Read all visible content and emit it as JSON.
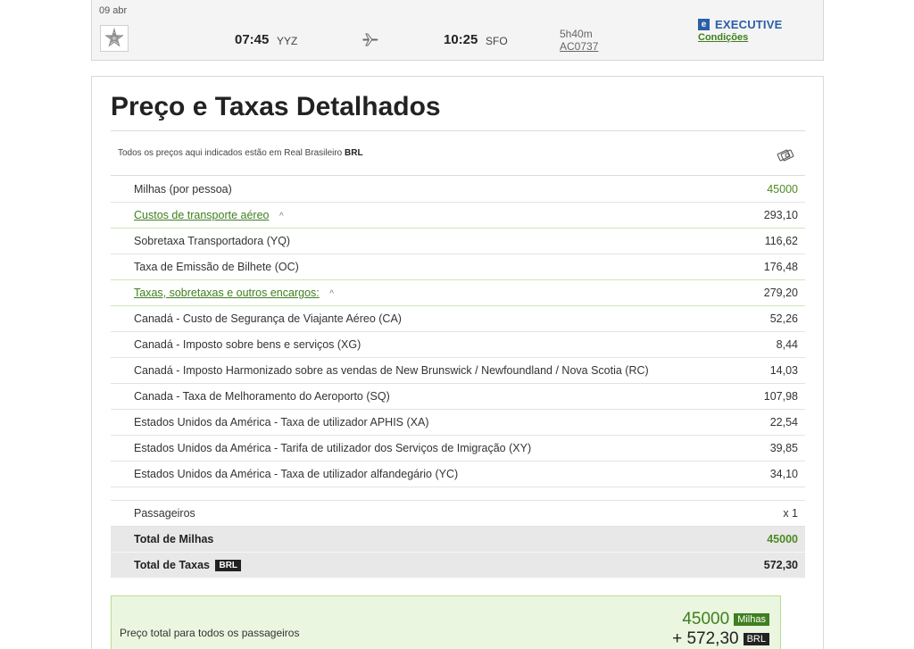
{
  "flight": {
    "date": "09 abr",
    "departure_time": "07:45",
    "departure_code": "YYZ",
    "arrival_time": "10:25",
    "arrival_code": "SFO",
    "duration": "5h40m",
    "flight_number": "AC0737",
    "cabin_mark": "e",
    "cabin": "EXECUTIVE",
    "conditions_link": "Condições",
    "icons": [
      "star-alliance-logo-icon",
      "airplane-icon"
    ],
    "colors": {
      "cabin": "#2b5ea6",
      "accent_green": "#3f7f1f"
    }
  },
  "panel": {
    "title": "Preço e Taxas Detalhados",
    "currency_note_prefix": "Todos os preços aqui indicados estão em Real Brasileiro",
    "currency_code": "BRL",
    "money_icon": "money-exchange-icon"
  },
  "rows": [
    {
      "label": "Milhas (por pessoa)",
      "value": "45000"
    },
    {
      "label": "Custos de transporte aéreo",
      "value": "293,10",
      "caret": "^"
    },
    {
      "label": "Sobretaxa Transportadora (YQ)",
      "value": "116,62"
    },
    {
      "label": "Taxa de Emissão de Bilhete (OC)",
      "value": "176,48"
    },
    {
      "label": "Taxas, sobretaxas e outros encargos:",
      "value": "279,20",
      "caret": "^"
    },
    {
      "label": "Canadá - Custo de Segurança de Viajante Aéreo (CA)",
      "value": "52,26"
    },
    {
      "label": "Canadá - Imposto sobre bens e serviços (XG)",
      "value": "8,44"
    },
    {
      "label": "Canadá - Imposto Harmonizado sobre as vendas de New Brunswick / Newfoundland / Nova Scotia (RC)",
      "value": "14,03"
    },
    {
      "label": "Canada - Taxa de Melhoramento do Aeroporto (SQ)",
      "value": "107,98"
    },
    {
      "label": "Estados Unidos da América - Taxa de utilizador APHIS (XA)",
      "value": "22,54"
    },
    {
      "label": "Estados Unidos da América - Tarifa de utilizador dos Serviços de Imigração (XY)",
      "value": "39,85"
    },
    {
      "label": "Estados Unidos da América - Taxa de utilizador alfandegário (YC)",
      "value": "34,10"
    }
  ],
  "passengers": {
    "label": "Passageiros",
    "value": "x 1"
  },
  "totals": {
    "miles_label": "Total de Milhas",
    "miles_value": "45000",
    "taxes_label": "Total de Taxas",
    "taxes_badge": "BRL",
    "taxes_value": "572,30"
  },
  "grand_total": {
    "label": "Preço total para todos os passageiros",
    "miles": "45000",
    "miles_badge": "Milhas",
    "taxes": "+ 572,30",
    "taxes_badge": "BRL"
  }
}
